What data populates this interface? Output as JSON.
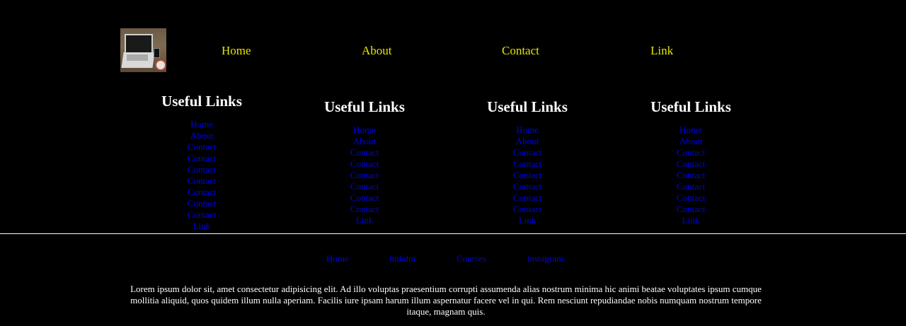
{
  "header": {
    "logo_alt": "laptop on desk",
    "nav": [
      "Home",
      "About",
      "Contact",
      "Link"
    ]
  },
  "columns": [
    {
      "title": "Useful Links",
      "links": [
        "Home",
        "About",
        "Contact",
        "Contact",
        "Contact",
        "Contact",
        "Contact",
        "Contact",
        "Contact",
        "Link"
      ]
    },
    {
      "title": "Useful Links",
      "links": [
        "Home",
        "About",
        "Contact",
        "Contact",
        "Contact",
        "Contact",
        "Contact",
        "Contact",
        "Link"
      ]
    },
    {
      "title": "Useful Links",
      "links": [
        "Home",
        "About",
        "Contact",
        "Contact",
        "Contact",
        "Contact",
        "Contact",
        "Contact",
        "Link"
      ]
    },
    {
      "title": "Useful Links",
      "links": [
        "Home",
        "About",
        "Contact",
        "Contact",
        "Contact",
        "Contact",
        "Contact",
        "Contact",
        "Link"
      ]
    }
  ],
  "footer": {
    "links": [
      "Home",
      "linkdin",
      "Courses",
      "instagram"
    ],
    "text": "Lorem ipsum dolor sit, amet consectetur adipisicing elit. Ad illo voluptas praesentium corrupti assumenda alias nostrum minima hic animi beatae voluptates ipsum cumque mollitia aliquid, quos quidem illum nulla aperiam. Facilis iure ipsam harum illum aspernatur facere vel in qui. Rem nesciunt repudiandae nobis numquam nostrum tempore itaque, magnam quis."
  },
  "colors": {
    "background": "#000000",
    "nav_link": "#e5e500",
    "link": "#0000ee",
    "text": "#ffffff"
  }
}
